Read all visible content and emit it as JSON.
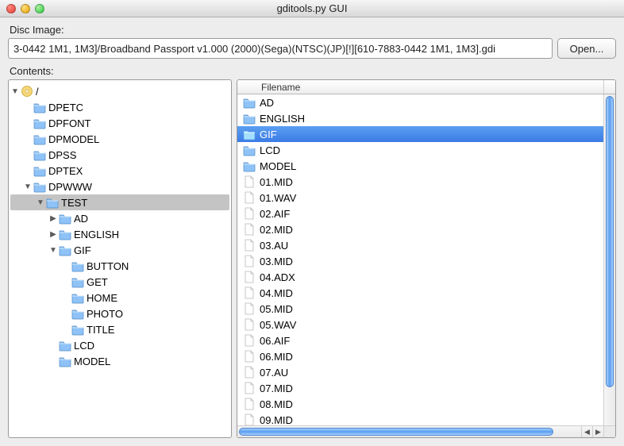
{
  "window": {
    "title": "gditools.py GUI"
  },
  "disc": {
    "label": "Disc Image:",
    "path": "3-0442 1M1, 1M3]/Broadband Passport v1.000 (2000)(Sega)(NTSC)(JP)[!][610-7883-0442 1M1, 1M3].gdi",
    "open_label": "Open..."
  },
  "contents": {
    "label": "Contents:"
  },
  "tree": {
    "root": {
      "label": "/",
      "icon": "disc-icon",
      "expanded": true,
      "children": [
        {
          "label": "DPETC",
          "icon": "folder-icon"
        },
        {
          "label": "DPFONT",
          "icon": "folder-icon"
        },
        {
          "label": "DPMODEL",
          "icon": "folder-icon"
        },
        {
          "label": "DPSS",
          "icon": "folder-icon"
        },
        {
          "label": "DPTEX",
          "icon": "folder-icon"
        },
        {
          "label": "DPWWW",
          "icon": "folder-icon",
          "expanded": true,
          "children": [
            {
              "label": "TEST",
              "icon": "folder-icon",
              "expanded": true,
              "selected": true,
              "children": [
                {
                  "label": "AD",
                  "icon": "folder-icon",
                  "hasChildren": true
                },
                {
                  "label": "ENGLISH",
                  "icon": "folder-icon",
                  "hasChildren": true
                },
                {
                  "label": "GIF",
                  "icon": "folder-icon",
                  "expanded": true,
                  "children": [
                    {
                      "label": "BUTTON",
                      "icon": "folder-icon"
                    },
                    {
                      "label": "GET",
                      "icon": "folder-icon"
                    },
                    {
                      "label": "HOME",
                      "icon": "folder-icon"
                    },
                    {
                      "label": "PHOTO",
                      "icon": "folder-icon"
                    },
                    {
                      "label": "TITLE",
                      "icon": "folder-icon"
                    }
                  ]
                },
                {
                  "label": "LCD",
                  "icon": "folder-icon"
                },
                {
                  "label": "MODEL",
                  "icon": "folder-icon"
                }
              ]
            }
          ]
        }
      ]
    }
  },
  "list": {
    "header": "Filename",
    "selected_index": 2,
    "items": [
      {
        "name": "AD",
        "type": "folder"
      },
      {
        "name": "ENGLISH",
        "type": "folder"
      },
      {
        "name": "GIF",
        "type": "folder"
      },
      {
        "name": "LCD",
        "type": "folder"
      },
      {
        "name": "MODEL",
        "type": "folder"
      },
      {
        "name": "01.MID",
        "type": "file"
      },
      {
        "name": "01.WAV",
        "type": "file"
      },
      {
        "name": "02.AIF",
        "type": "file"
      },
      {
        "name": "02.MID",
        "type": "file"
      },
      {
        "name": "03.AU",
        "type": "file"
      },
      {
        "name": "03.MID",
        "type": "file"
      },
      {
        "name": "04.ADX",
        "type": "file"
      },
      {
        "name": "04.MID",
        "type": "file"
      },
      {
        "name": "05.MID",
        "type": "file"
      },
      {
        "name": "05.WAV",
        "type": "file"
      },
      {
        "name": "06.AIF",
        "type": "file"
      },
      {
        "name": "06.MID",
        "type": "file"
      },
      {
        "name": "07.AU",
        "type": "file"
      },
      {
        "name": "07.MID",
        "type": "file"
      },
      {
        "name": "08.MID",
        "type": "file"
      },
      {
        "name": "09.MID",
        "type": "file"
      }
    ]
  }
}
